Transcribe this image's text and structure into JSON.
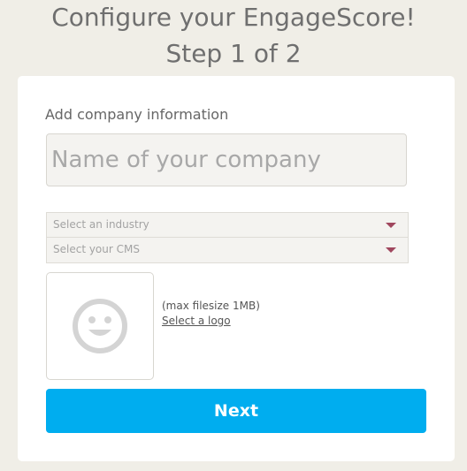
{
  "header": {
    "title_line_1": "Configure your EngageScore!",
    "title_line_2": "Step 1 of 2"
  },
  "form": {
    "section_label": "Add company information",
    "company_name": {
      "value": "",
      "placeholder": "Name of your company"
    },
    "industry_select": {
      "selected": "Select an industry",
      "icon": "chevron-down-icon"
    },
    "cms_select": {
      "selected": "Select your CMS",
      "icon": "chevron-down-icon"
    },
    "logo": {
      "icon": "smiley-face-icon",
      "max_filesize_text": "(max filesize 1MB)",
      "select_link_text": "Select a logo"
    },
    "next_button_label": "Next"
  },
  "colors": {
    "background": "#f0eee7",
    "card": "#ffffff",
    "accent_button": "#00adef",
    "select_arrow": "#a0475e",
    "title_text": "#6f6f6f"
  }
}
